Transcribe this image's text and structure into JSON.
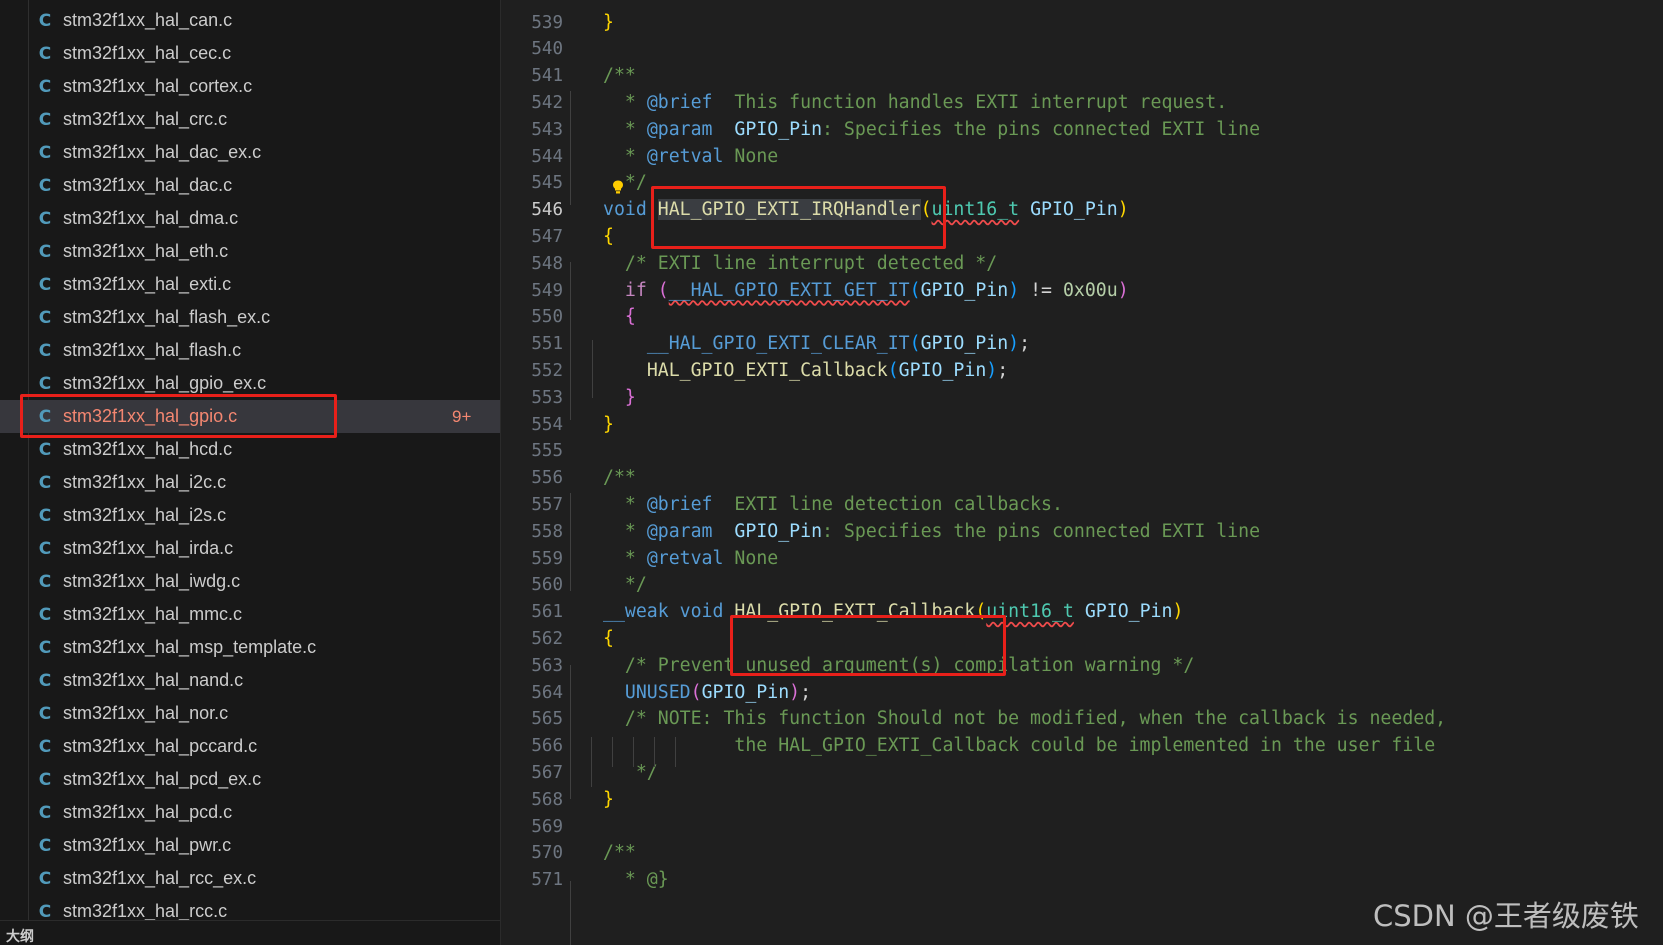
{
  "explorer": {
    "files": [
      {
        "icon": "C",
        "name": "stm32f1xx_hal_can.c"
      },
      {
        "icon": "C",
        "name": "stm32f1xx_hal_cec.c"
      },
      {
        "icon": "C",
        "name": "stm32f1xx_hal_cortex.c"
      },
      {
        "icon": "C",
        "name": "stm32f1xx_hal_crc.c"
      },
      {
        "icon": "C",
        "name": "stm32f1xx_hal_dac_ex.c"
      },
      {
        "icon": "C",
        "name": "stm32f1xx_hal_dac.c"
      },
      {
        "icon": "C",
        "name": "stm32f1xx_hal_dma.c"
      },
      {
        "icon": "C",
        "name": "stm32f1xx_hal_eth.c"
      },
      {
        "icon": "C",
        "name": "stm32f1xx_hal_exti.c"
      },
      {
        "icon": "C",
        "name": "stm32f1xx_hal_flash_ex.c"
      },
      {
        "icon": "C",
        "name": "stm32f1xx_hal_flash.c"
      },
      {
        "icon": "C",
        "name": "stm32f1xx_hal_gpio_ex.c"
      },
      {
        "icon": "C",
        "name": "stm32f1xx_hal_gpio.c",
        "badge": "9+",
        "selected": true
      },
      {
        "icon": "C",
        "name": "stm32f1xx_hal_hcd.c"
      },
      {
        "icon": "C",
        "name": "stm32f1xx_hal_i2c.c"
      },
      {
        "icon": "C",
        "name": "stm32f1xx_hal_i2s.c"
      },
      {
        "icon": "C",
        "name": "stm32f1xx_hal_irda.c"
      },
      {
        "icon": "C",
        "name": "stm32f1xx_hal_iwdg.c"
      },
      {
        "icon": "C",
        "name": "stm32f1xx_hal_mmc.c"
      },
      {
        "icon": "C",
        "name": "stm32f1xx_hal_msp_template.c"
      },
      {
        "icon": "C",
        "name": "stm32f1xx_hal_nand.c"
      },
      {
        "icon": "C",
        "name": "stm32f1xx_hal_nor.c"
      },
      {
        "icon": "C",
        "name": "stm32f1xx_hal_pccard.c"
      },
      {
        "icon": "C",
        "name": "stm32f1xx_hal_pcd_ex.c"
      },
      {
        "icon": "C",
        "name": "stm32f1xx_hal_pcd.c"
      },
      {
        "icon": "C",
        "name": "stm32f1xx_hal_pwr.c"
      },
      {
        "icon": "C",
        "name": "stm32f1xx_hal_rcc_ex.c"
      },
      {
        "icon": "C",
        "name": "stm32f1xx_hal_rcc.c"
      }
    ],
    "outline_label": "大纲",
    "file_icon_color": "#519aba",
    "selected_color": "#f48771"
  },
  "editor": {
    "active_line": "546",
    "lines": [
      {
        "n": "539",
        "tokens": [
          [
            "tk-b1",
            "}"
          ]
        ]
      },
      {
        "n": "540",
        "tokens": []
      },
      {
        "n": "541",
        "tokens": [
          [
            "tk-cm",
            "/**"
          ]
        ]
      },
      {
        "n": "542",
        "tokens": [
          [
            "tk-cm",
            "  * "
          ],
          [
            "tk-tag",
            "@brief"
          ],
          [
            "tk-cm",
            "  This function handles EXTI interrupt request."
          ]
        ]
      },
      {
        "n": "543",
        "tokens": [
          [
            "tk-cm",
            "  * "
          ],
          [
            "tk-tag",
            "@param"
          ],
          [
            "tk-cm",
            "  "
          ],
          [
            "tk-var",
            "GPIO_Pin"
          ],
          [
            "tk-cm",
            ": Specifies the pins connected EXTI line"
          ]
        ]
      },
      {
        "n": "544",
        "tokens": [
          [
            "tk-cm",
            "  * "
          ],
          [
            "tk-tag",
            "@retval"
          ],
          [
            "tk-cm",
            " None"
          ]
        ]
      },
      {
        "n": "545",
        "tokens": [
          [
            "tk-cm",
            "  */"
          ]
        ]
      },
      {
        "n": "546",
        "tokens": [
          [
            "tk-kw",
            "void"
          ],
          [
            "tk-op",
            " "
          ],
          [
            "tk-fn selbg",
            "HAL_GPIO_EXTI_IRQHandler"
          ],
          [
            "tk-b1",
            "("
          ],
          [
            "tk-ty squiggle",
            "uint16_t"
          ],
          [
            "tk-op",
            " "
          ],
          [
            "tk-var",
            "GPIO_Pin"
          ],
          [
            "tk-b1",
            ")"
          ]
        ]
      },
      {
        "n": "547",
        "tokens": [
          [
            "tk-b1",
            "{"
          ]
        ]
      },
      {
        "n": "548",
        "tokens": [
          [
            "tk-cm",
            "  /* EXTI line interrupt detected */"
          ]
        ]
      },
      {
        "n": "549",
        "tokens": [
          [
            "tk-op",
            "  "
          ],
          [
            "tk-ctl",
            "if"
          ],
          [
            "tk-op",
            " "
          ],
          [
            "tk-b2",
            "("
          ],
          [
            "tk-mac squiggle",
            "__HAL_GPIO_EXTI_GET_IT"
          ],
          [
            "tk-b3",
            "("
          ],
          [
            "tk-var",
            "GPIO_Pin"
          ],
          [
            "tk-b3",
            ")"
          ],
          [
            "tk-op",
            " != "
          ],
          [
            "tk-num",
            "0x00u"
          ],
          [
            "tk-b2",
            ")"
          ]
        ]
      },
      {
        "n": "550",
        "tokens": [
          [
            "tk-op",
            "  "
          ],
          [
            "tk-b2",
            "{"
          ]
        ]
      },
      {
        "n": "551",
        "tokens": [
          [
            "tk-op",
            "    "
          ],
          [
            "tk-mac",
            "__HAL_GPIO_EXTI_CLEAR_IT"
          ],
          [
            "tk-b3",
            "("
          ],
          [
            "tk-var",
            "GPIO_Pin"
          ],
          [
            "tk-b3",
            ")"
          ],
          [
            "tk-op",
            ";"
          ]
        ]
      },
      {
        "n": "552",
        "tokens": [
          [
            "tk-op",
            "    "
          ],
          [
            "tk-fn",
            "HAL_GPIO_EXTI_Callback"
          ],
          [
            "tk-b3",
            "("
          ],
          [
            "tk-var",
            "GPIO_Pin"
          ],
          [
            "tk-b3",
            ")"
          ],
          [
            "tk-op",
            ";"
          ]
        ]
      },
      {
        "n": "553",
        "tokens": [
          [
            "tk-op",
            "  "
          ],
          [
            "tk-b2",
            "}"
          ]
        ]
      },
      {
        "n": "554",
        "tokens": [
          [
            "tk-b1",
            "}"
          ]
        ]
      },
      {
        "n": "555",
        "tokens": []
      },
      {
        "n": "556",
        "tokens": [
          [
            "tk-cm",
            "/**"
          ]
        ]
      },
      {
        "n": "557",
        "tokens": [
          [
            "tk-cm",
            "  * "
          ],
          [
            "tk-tag",
            "@brief"
          ],
          [
            "tk-cm",
            "  EXTI line detection callbacks."
          ]
        ]
      },
      {
        "n": "558",
        "tokens": [
          [
            "tk-cm",
            "  * "
          ],
          [
            "tk-tag",
            "@param"
          ],
          [
            "tk-cm",
            "  "
          ],
          [
            "tk-var",
            "GPIO_Pin"
          ],
          [
            "tk-cm",
            ": Specifies the pins connected EXTI line"
          ]
        ]
      },
      {
        "n": "559",
        "tokens": [
          [
            "tk-cm",
            "  * "
          ],
          [
            "tk-tag",
            "@retval"
          ],
          [
            "tk-cm",
            " None"
          ]
        ]
      },
      {
        "n": "560",
        "tokens": [
          [
            "tk-cm",
            "  */"
          ]
        ]
      },
      {
        "n": "561",
        "tokens": [
          [
            "tk-kw",
            "__weak"
          ],
          [
            "tk-op",
            " "
          ],
          [
            "tk-kw",
            "void"
          ],
          [
            "tk-op",
            " "
          ],
          [
            "tk-fn",
            "HAL_GPIO_EXTI_Callback"
          ],
          [
            "tk-b1",
            "("
          ],
          [
            "tk-ty squiggle",
            "uint16_t"
          ],
          [
            "tk-op",
            " "
          ],
          [
            "tk-var",
            "GPIO_Pin"
          ],
          [
            "tk-b1",
            ")"
          ]
        ]
      },
      {
        "n": "562",
        "tokens": [
          [
            "tk-b1",
            "{"
          ]
        ]
      },
      {
        "n": "563",
        "tokens": [
          [
            "tk-cm",
            "  /* Prevent unused argument(s) compilation warning */"
          ]
        ]
      },
      {
        "n": "564",
        "tokens": [
          [
            "tk-op",
            "  "
          ],
          [
            "tk-mac",
            "UNUSED"
          ],
          [
            "tk-b2",
            "("
          ],
          [
            "tk-var",
            "GPIO_Pin"
          ],
          [
            "tk-b2",
            ")"
          ],
          [
            "tk-op",
            ";"
          ]
        ]
      },
      {
        "n": "565",
        "tokens": [
          [
            "tk-cm",
            "  /* NOTE: This function Should not be modified, when the callback is needed,"
          ]
        ]
      },
      {
        "n": "566",
        "tokens": [
          [
            "tk-cm",
            "            the HAL_GPIO_EXTI_Callback could be implemented in the user file"
          ]
        ]
      },
      {
        "n": "567",
        "tokens": [
          [
            "tk-cm",
            "   */"
          ]
        ]
      },
      {
        "n": "568",
        "tokens": [
          [
            "tk-b1",
            "}"
          ]
        ]
      },
      {
        "n": "569",
        "tokens": []
      },
      {
        "n": "570",
        "tokens": [
          [
            "tk-cm",
            "/**"
          ]
        ]
      },
      {
        "n": "571",
        "tokens": [
          [
            "tk-cm",
            "  * @}"
          ]
        ]
      }
    ]
  },
  "watermark": "CSDN @王者级废铁",
  "highlight_color": "#e8201a"
}
